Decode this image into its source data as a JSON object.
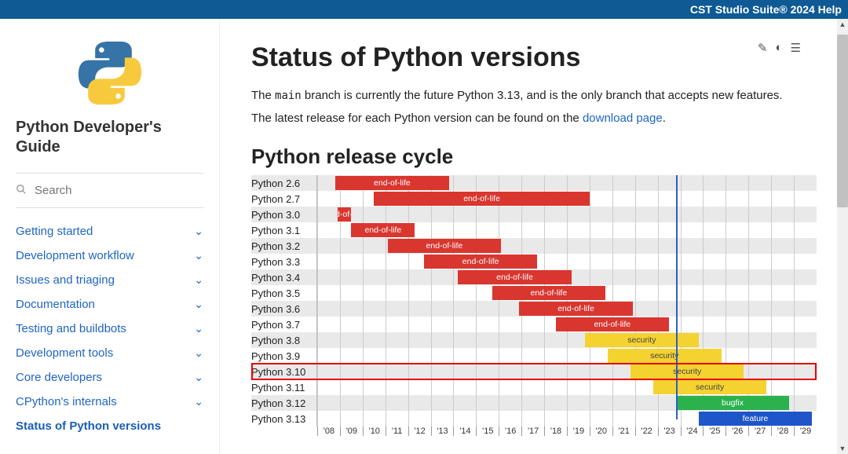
{
  "header": {
    "help_label": "CST Studio Suite® 2024 Help"
  },
  "sidebar": {
    "title": "Python Developer's Guide",
    "search_placeholder": "Search",
    "nav": [
      {
        "label": "Getting started"
      },
      {
        "label": "Development workflow"
      },
      {
        "label": "Issues and triaging"
      },
      {
        "label": "Documentation"
      },
      {
        "label": "Testing and buildbots"
      },
      {
        "label": "Development tools"
      },
      {
        "label": "Core developers"
      },
      {
        "label": "CPython's internals"
      }
    ],
    "active_label": "Status of Python versions"
  },
  "main": {
    "title": "Status of Python versions",
    "intro_pre": "The ",
    "intro_code": "main",
    "intro_post": " branch is currently the future Python 3.13, and is the only branch that accepts new features.",
    "intro2_pre": "The latest release for each Python version can be found on the ",
    "intro2_link": "download page",
    "intro2_post": ".",
    "sub_heading": "Python release cycle",
    "highlight_row_index": 12
  },
  "chart_data": {
    "type": "gantt",
    "title": "Python release cycle",
    "x_start": 2008,
    "x_end": 2030,
    "x_ticks": [
      "'08",
      "'09",
      "'10",
      "'11",
      "'12",
      "'13",
      "'14",
      "'15",
      "'16",
      "'17",
      "'18",
      "'19",
      "'20",
      "'21",
      "'22",
      "'23",
      "'24",
      "'25",
      "'26",
      "'27",
      "'28",
      "'29"
    ],
    "now": 2023.8,
    "rows": [
      {
        "label": "Python 2.6",
        "bars": [
          {
            "kind": "eol",
            "start": 2008.8,
            "end": 2013.8,
            "text": "end-of-life"
          }
        ]
      },
      {
        "label": "Python 2.7",
        "bars": [
          {
            "kind": "eol",
            "start": 2010.5,
            "end": 2020.0,
            "text": "end-of-life"
          }
        ]
      },
      {
        "label": "Python 3.0",
        "bars": [
          {
            "kind": "eol",
            "start": 2008.9,
            "end": 2009.5,
            "text": "end-of-life"
          }
        ]
      },
      {
        "label": "Python 3.1",
        "bars": [
          {
            "kind": "eol",
            "start": 2009.5,
            "end": 2012.3,
            "text": "end-of-life"
          }
        ]
      },
      {
        "label": "Python 3.2",
        "bars": [
          {
            "kind": "eol",
            "start": 2011.1,
            "end": 2016.1,
            "text": "end-of-life"
          }
        ]
      },
      {
        "label": "Python 3.3",
        "bars": [
          {
            "kind": "eol",
            "start": 2012.7,
            "end": 2017.7,
            "text": "end-of-life"
          }
        ]
      },
      {
        "label": "Python 3.4",
        "bars": [
          {
            "kind": "eol",
            "start": 2014.2,
            "end": 2019.2,
            "text": "end-of-life"
          }
        ]
      },
      {
        "label": "Python 3.5",
        "bars": [
          {
            "kind": "eol",
            "start": 2015.7,
            "end": 2020.7,
            "text": "end-of-life"
          }
        ]
      },
      {
        "label": "Python 3.6",
        "bars": [
          {
            "kind": "eol",
            "start": 2016.9,
            "end": 2021.9,
            "text": "end-of-life"
          }
        ]
      },
      {
        "label": "Python 3.7",
        "bars": [
          {
            "kind": "eol",
            "start": 2018.5,
            "end": 2023.5,
            "text": "end-of-life"
          }
        ]
      },
      {
        "label": "Python 3.8",
        "bars": [
          {
            "kind": "sec",
            "start": 2019.8,
            "end": 2024.8,
            "text": "security"
          }
        ]
      },
      {
        "label": "Python 3.9",
        "bars": [
          {
            "kind": "sec",
            "start": 2020.8,
            "end": 2025.8,
            "text": "security"
          }
        ]
      },
      {
        "label": "Python 3.10",
        "bars": [
          {
            "kind": "sec",
            "start": 2021.8,
            "end": 2026.8,
            "text": "security"
          }
        ]
      },
      {
        "label": "Python 3.11",
        "bars": [
          {
            "kind": "sec",
            "start": 2022.8,
            "end": 2027.8,
            "text": "security"
          }
        ]
      },
      {
        "label": "Python 3.12",
        "bars": [
          {
            "kind": "fix",
            "start": 2023.8,
            "end": 2028.8,
            "text": "bugfix"
          }
        ]
      },
      {
        "label": "Python 3.13",
        "bars": [
          {
            "kind": "fea",
            "start": 2024.8,
            "end": 2029.8,
            "text": "feature"
          }
        ]
      }
    ]
  }
}
